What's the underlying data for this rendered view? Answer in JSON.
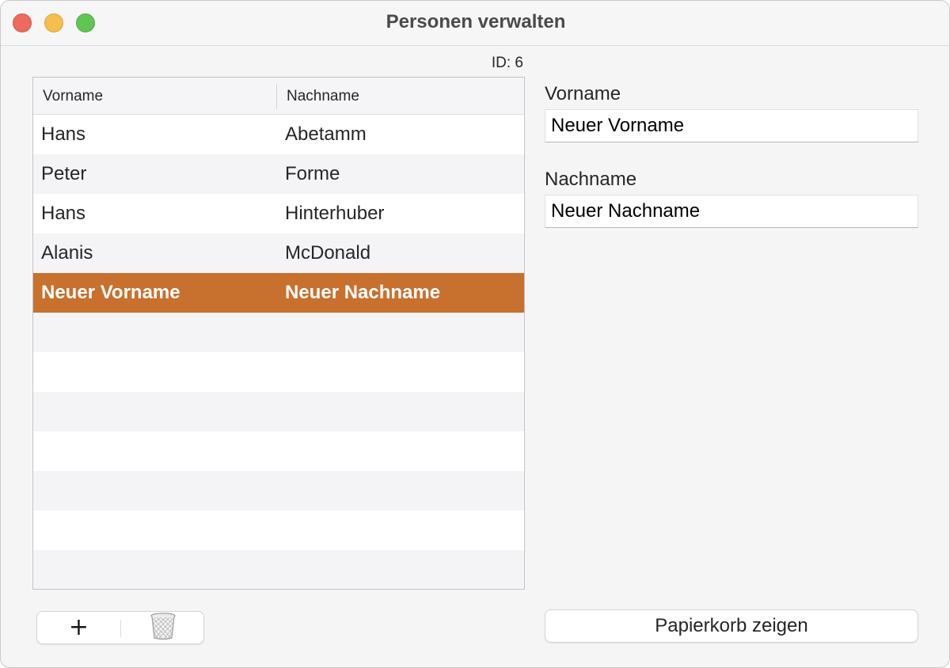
{
  "window": {
    "title": "Personen verwalten"
  },
  "record": {
    "id_label": "ID: 6"
  },
  "table": {
    "columns": [
      "Vorname",
      "Nachname"
    ],
    "rows": [
      {
        "vorname": "Hans",
        "nachname": "Abetamm"
      },
      {
        "vorname": "Peter",
        "nachname": "Forme"
      },
      {
        "vorname": "Hans",
        "nachname": "Hinterhuber"
      },
      {
        "vorname": "Alanis",
        "nachname": "McDonald"
      },
      {
        "vorname": "Neuer Vorname",
        "nachname": "Neuer Nachname"
      }
    ],
    "selected_row": 4
  },
  "form": {
    "vorname_label": "Vorname",
    "vorname_value": "Neuer Vorname",
    "nachname_label": "Nachname",
    "nachname_value": "Neuer Nachname"
  },
  "toolbar": {
    "add_label": "+",
    "remove_icon": "trash-icon",
    "trash_button_label": "Papierkorb zeigen"
  },
  "colors": {
    "selection": "#c8702d",
    "close": "#ec6a5e",
    "minimize": "#f4bf4f",
    "zoom": "#61c554"
  }
}
